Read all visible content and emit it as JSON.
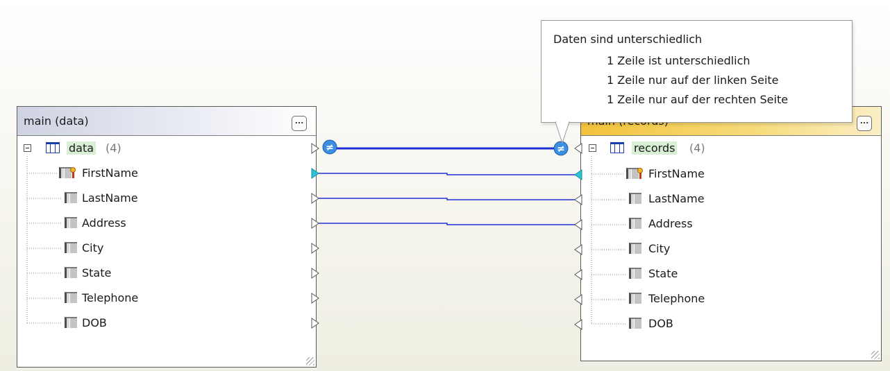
{
  "left_component": {
    "title": "main (data)",
    "root": {
      "label": "data",
      "count": "(4)"
    },
    "columns": [
      {
        "label": "FirstName",
        "key": true
      },
      {
        "label": "LastName",
        "key": false
      },
      {
        "label": "Address",
        "key": false
      },
      {
        "label": "City",
        "key": false
      },
      {
        "label": "State",
        "key": false
      },
      {
        "label": "Telephone",
        "key": false
      },
      {
        "label": "DOB",
        "key": false
      }
    ]
  },
  "right_component": {
    "title": "main (records)",
    "root": {
      "label": "records",
      "count": "(4)"
    },
    "columns": [
      {
        "label": "FirstName",
        "key": true
      },
      {
        "label": "LastName",
        "key": false
      },
      {
        "label": "Address",
        "key": false
      },
      {
        "label": "City",
        "key": false
      },
      {
        "label": "State",
        "key": false
      },
      {
        "label": "Telephone",
        "key": false
      },
      {
        "label": "DOB",
        "key": false
      }
    ]
  },
  "tooltip": {
    "title": "Daten sind unterschiedlich",
    "lines": [
      "1 Zeile ist unterschiedlich",
      "1 Zeile nur auf der linken Seite",
      "1 Zeile nur auf der rechten Seite"
    ]
  },
  "diff_symbol": "≠",
  "colors": {
    "connection_line": "#1e2fd6",
    "diff_badge": "#3c8fe0",
    "mapped_connector": "#29c4d6",
    "left_header": "#cfd3e2",
    "right_header": "#f2c33a",
    "root_highlight": "#d7f0d4"
  }
}
